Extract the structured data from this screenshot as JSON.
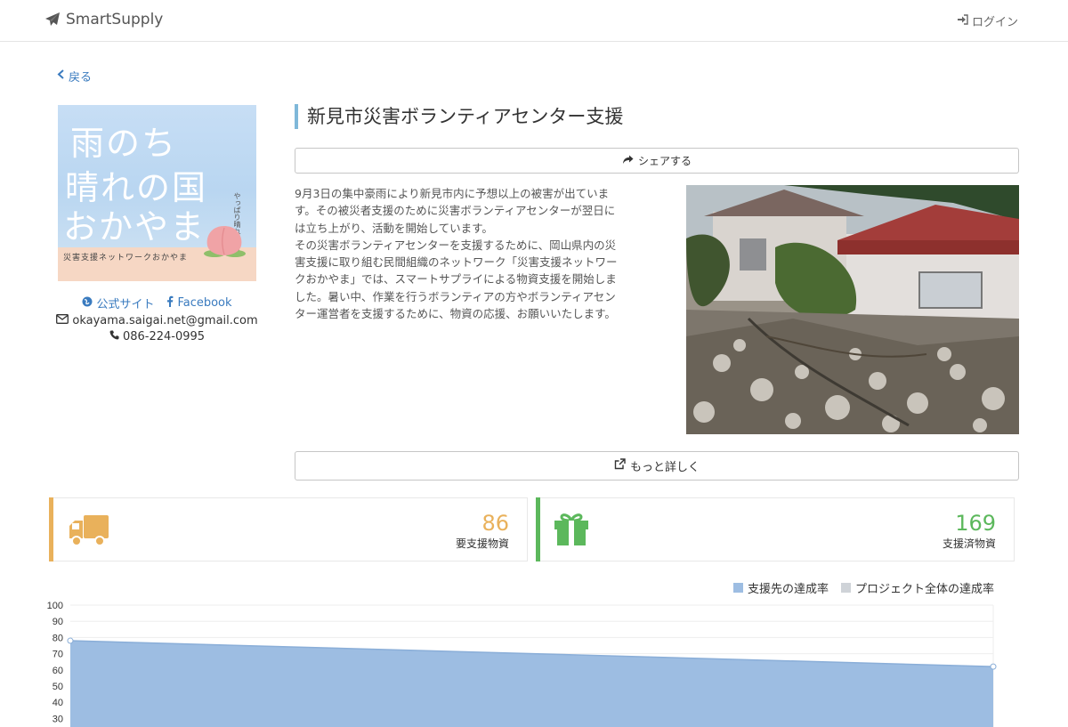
{
  "nav": {
    "brand": "SmartSupply",
    "login_label": "ログイン"
  },
  "back_label": "戻る",
  "organization": {
    "logo_text_line1": "雨のち",
    "logo_text_line2": "晴れの国",
    "logo_text_line3": "おかやま",
    "logo_side_text": "やっぱり晴れるな！",
    "logo_band_text": "災害支援ネットワークおかやま",
    "official_site_label": "公式サイト",
    "facebook_label": "Facebook",
    "email": "okayama.saigai.net@gmail.com",
    "phone": "086-224-0995"
  },
  "project": {
    "title": "新見市災害ボランティアセンター支援",
    "share_label": "シェアする",
    "more_label": "もっと詳しく",
    "description_lines": [
      "9月3日の集中豪雨により新見市内に予想以上の被害が出ていま",
      "す。その被災者支援のために災害ボランティアセンターが翌日に",
      "は立ち上がり、活動を開始しています。",
      "その災害ボランティアセンターを支援するために、岡山県内の災",
      "害支援に取り組む民間組織のネットワーク「災害支援ネットワー",
      "クおかやま」では、スマートサプライによる物資支援を開始しま",
      "した。暑い中、作業を行うボランティアの方やボランティアセン",
      "ター運営者を支援するために、物資の応援、お願いいたします。"
    ]
  },
  "stats": {
    "needed": {
      "value": "86",
      "label": "要支援物資",
      "color": "#e9b15b"
    },
    "supported": {
      "value": "169",
      "label": "支援済物資",
      "color": "#5cb85c"
    }
  },
  "icons": {
    "brand": "paper-plane-icon",
    "login": "sign-in-icon",
    "back": "chevron-left-icon",
    "globe": "globe-icon",
    "facebook": "facebook-icon",
    "email": "envelope-icon",
    "phone": "phone-icon",
    "share": "share-icon",
    "more": "external-link-icon",
    "needed": "truck-icon",
    "supported": "gift-icon"
  },
  "chart_data": {
    "type": "area",
    "ylim": [
      0,
      100
    ],
    "yticks": [
      100,
      90,
      80,
      70,
      60,
      50,
      40,
      30
    ],
    "series": [
      {
        "name": "支援先の達成率",
        "color": "#9dbde2",
        "values": [
          78,
          62
        ]
      },
      {
        "name": "プロジェクト全体の達成率",
        "color": "#cfd3d8",
        "values": []
      }
    ],
    "legend_position": "top-right",
    "grid": true
  }
}
